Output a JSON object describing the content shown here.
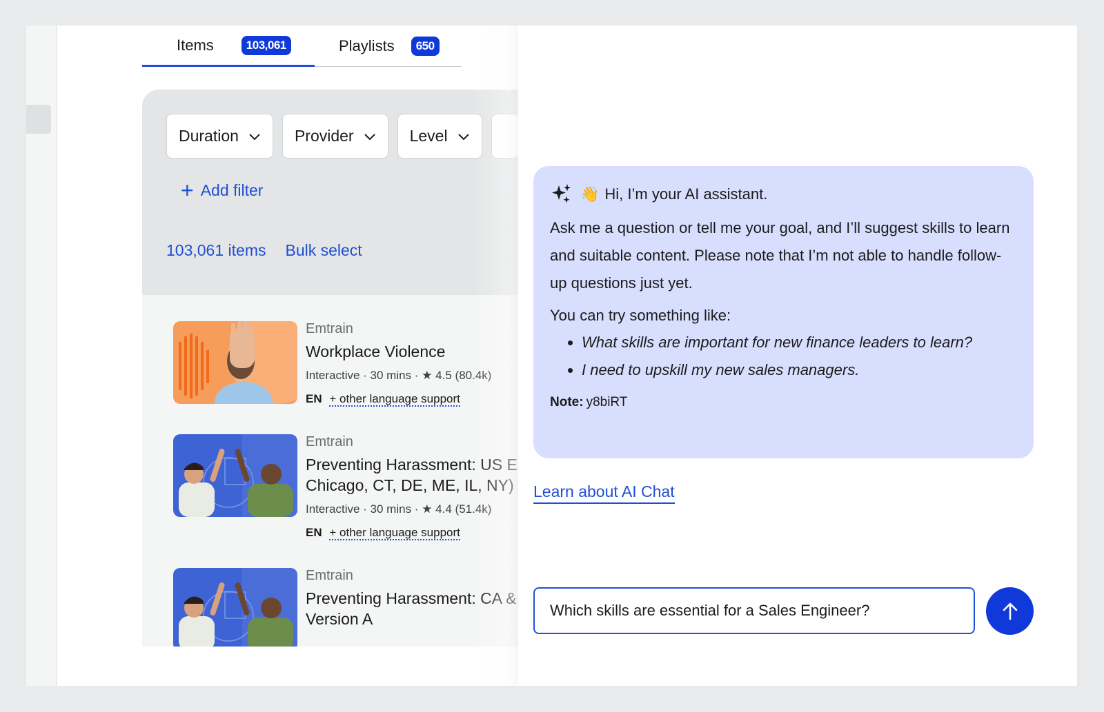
{
  "tabs": [
    {
      "label": "Items",
      "count": "103,061"
    },
    {
      "label": "Playlists",
      "count": "650"
    }
  ],
  "filters": [
    {
      "label": "Duration"
    },
    {
      "label": "Provider"
    },
    {
      "label": "Level"
    }
  ],
  "add_filter_label": "Add filter",
  "results": {
    "count_label": "103,061 items",
    "bulk_select_label": "Bulk select"
  },
  "courses": [
    {
      "provider": "Emtrain",
      "title_line1": "Workplace Violence",
      "title_line2": "",
      "type": "Interactive",
      "duration": "30 mins",
      "rating": "4.5",
      "reviews": "(80.4k)",
      "language": "EN",
      "language_more": "+ other language support"
    },
    {
      "provider": "Emtrain",
      "title_line1": "Preventing Harassment: US E",
      "title_line2": "Chicago, CT, DE, ME, IL, NY) - V",
      "type": "Interactive",
      "duration": "30 mins",
      "rating": "4.4",
      "reviews": "(51.4k)",
      "language": "EN",
      "language_more": "+ other language support"
    },
    {
      "provider": "Emtrain",
      "title_line1": "Preventing Harassment: CA &",
      "title_line2": "Version A"
    }
  ],
  "ai_chat": {
    "greeting": "Hi, I’m your AI assistant.",
    "intro": "Ask me a question or tell me your goal, and I’ll suggest skills to learn and suitable content. Please note that I’m not able to handle follow-up questions just yet.",
    "try_label": "You can try something like:",
    "examples": [
      "What skills are important for new finance leaders to learn?",
      "I need to upskill my new sales managers."
    ],
    "note_label": "Note:",
    "note_value": "y8biRT",
    "learn_link": "Learn about AI Chat",
    "input_value": "Which skills are essential for a Sales Engineer?"
  },
  "colors": {
    "accent": "#1f4fd6",
    "badge": "#0f3ad9",
    "ai_bubble": "#d8defd"
  },
  "icons": [
    "chevron-down-icon",
    "plus-icon",
    "sparkle-icon",
    "waving-hand-icon",
    "star-icon",
    "arrow-up-icon"
  ]
}
